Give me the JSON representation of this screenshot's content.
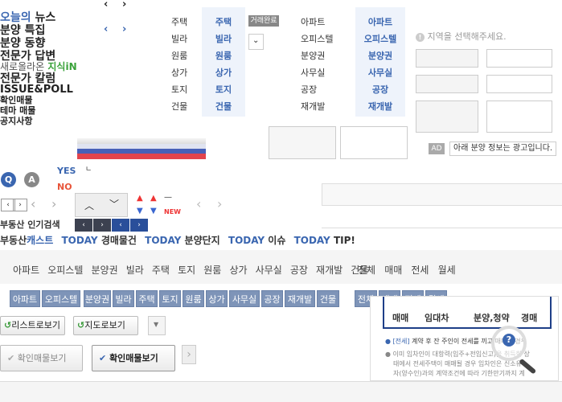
{
  "leftnav": {
    "items": [
      {
        "a": "오늘의",
        "b": " 뉴스"
      },
      {
        "a": "분양 특집",
        "b": ""
      },
      {
        "a": "분양 동향",
        "b": ""
      },
      {
        "a": "전문가 답변",
        "b": ""
      },
      {
        "a": "새로올라온",
        "b": " 지식iN"
      },
      {
        "a": "전문가 칼럼",
        "b": ""
      },
      {
        "a": "ISSUE&POLL",
        "b": ""
      },
      {
        "a": "확인매물",
        "b": ""
      },
      {
        "a": "테마 매물",
        "b": ""
      },
      {
        "a": "공지사항",
        "b": ""
      }
    ]
  },
  "col1": [
    "주택",
    "빌라",
    "원룸",
    "상가",
    "토지",
    "건물"
  ],
  "col2": [
    "주택",
    "빌라",
    "원룸",
    "상가",
    "토지",
    "건물"
  ],
  "trade_label": "거래완료",
  "col3": [
    "아파트",
    "오피스텔",
    "분양권",
    "사무실",
    "공장",
    "재개발"
  ],
  "col4": [
    "아파트",
    "오피스텔",
    "분양권",
    "사무실",
    "공장",
    "재개발"
  ],
  "region_notice": "지역을 선택해주세요.",
  "ad_label": "AD",
  "ad_text": "아래 분양 정보는 광고입니다.",
  "q_label": "Q",
  "a_label": "A",
  "yes_label": "YES",
  "no_label": "NO",
  "new_label": "NEW",
  "popular_search": "부동산 인기검색",
  "today_row": {
    "cast_a": "부동산",
    "cast_b": "캐스트",
    "items": [
      {
        "a": "TODAY",
        "b": "경매물건"
      },
      {
        "a": "TODAY",
        "b": "분양단지"
      },
      {
        "a": "TODAY",
        "b": "이슈"
      },
      {
        "a": "TODAY",
        "b": "TIP!"
      }
    ]
  },
  "tabs_plain": [
    "아파트",
    "오피스텔",
    "분양권",
    "빌라",
    "주택",
    "토지",
    "원룸",
    "상가",
    "사무실",
    "공장",
    "재개발",
    "건물"
  ],
  "deal_tabs_plain": [
    "전체",
    "매매",
    "전세",
    "월세"
  ],
  "tabs_blue": [
    "아파트",
    "오피스텔",
    "분양권",
    "빌라",
    "주택",
    "토지",
    "원룸",
    "상가",
    "사무실",
    "공장",
    "재개발",
    "건물"
  ],
  "deal_tabs_blue": [
    "전체",
    "매매",
    "전세",
    "월세"
  ],
  "btn_list": "리스트로보기",
  "btn_map": "지도로보기",
  "btn_confirm1": "확인매물보기",
  "btn_confirm2": "확인매물보기",
  "panel": {
    "tabs": [
      "매매",
      "임대차",
      "분양,청약",
      "경매"
    ],
    "line1_tag": "[전세]",
    "line1": "계약 후 잔 주인이 전세를 끼고 매매할 경우",
    "line2": "이미 임차인이 대항력(입주+전입신고)을 취득한 상",
    "line3": "태에서 전세주택이 매매될 경우 임차인은 신소유",
    "line4": "자(양수인)과의 계약조건에 따라 기한만기까지 계"
  }
}
